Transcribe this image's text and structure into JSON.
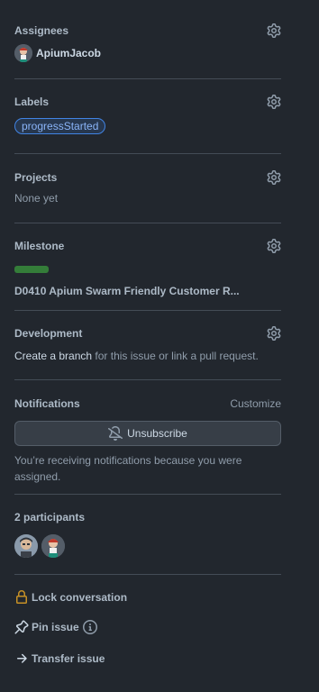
{
  "assignees": {
    "title": "Assignees",
    "items": [
      {
        "name": "ApiumJacob"
      }
    ]
  },
  "labels": {
    "title": "Labels",
    "items": [
      {
        "name": "progressStarted",
        "color": "#4184e4"
      }
    ]
  },
  "projects": {
    "title": "Projects",
    "empty_text": "None yet"
  },
  "milestone": {
    "title": "Milestone",
    "progress_percent": 100,
    "progress_color": "#347d39",
    "name": "D0410 Apium Swarm Friendly Customer R..."
  },
  "development": {
    "title": "Development",
    "link_text": "Create a branch",
    "rest_text": "for this issue or link a pull request."
  },
  "notifications": {
    "title": "Notifications",
    "customize_label": "Customize",
    "unsubscribe_label": "Unsubscribe",
    "notice_text": "You’re receiving notifications because you were assigned."
  },
  "participants": {
    "title": "2 participants",
    "count": 2
  },
  "actions": {
    "lock_label": "Lock conversation",
    "pin_label": "Pin issue",
    "transfer_label": "Transfer issue"
  },
  "colors": {
    "background": "#22272e",
    "border": "#444c56",
    "lock_icon": "#c69026"
  }
}
